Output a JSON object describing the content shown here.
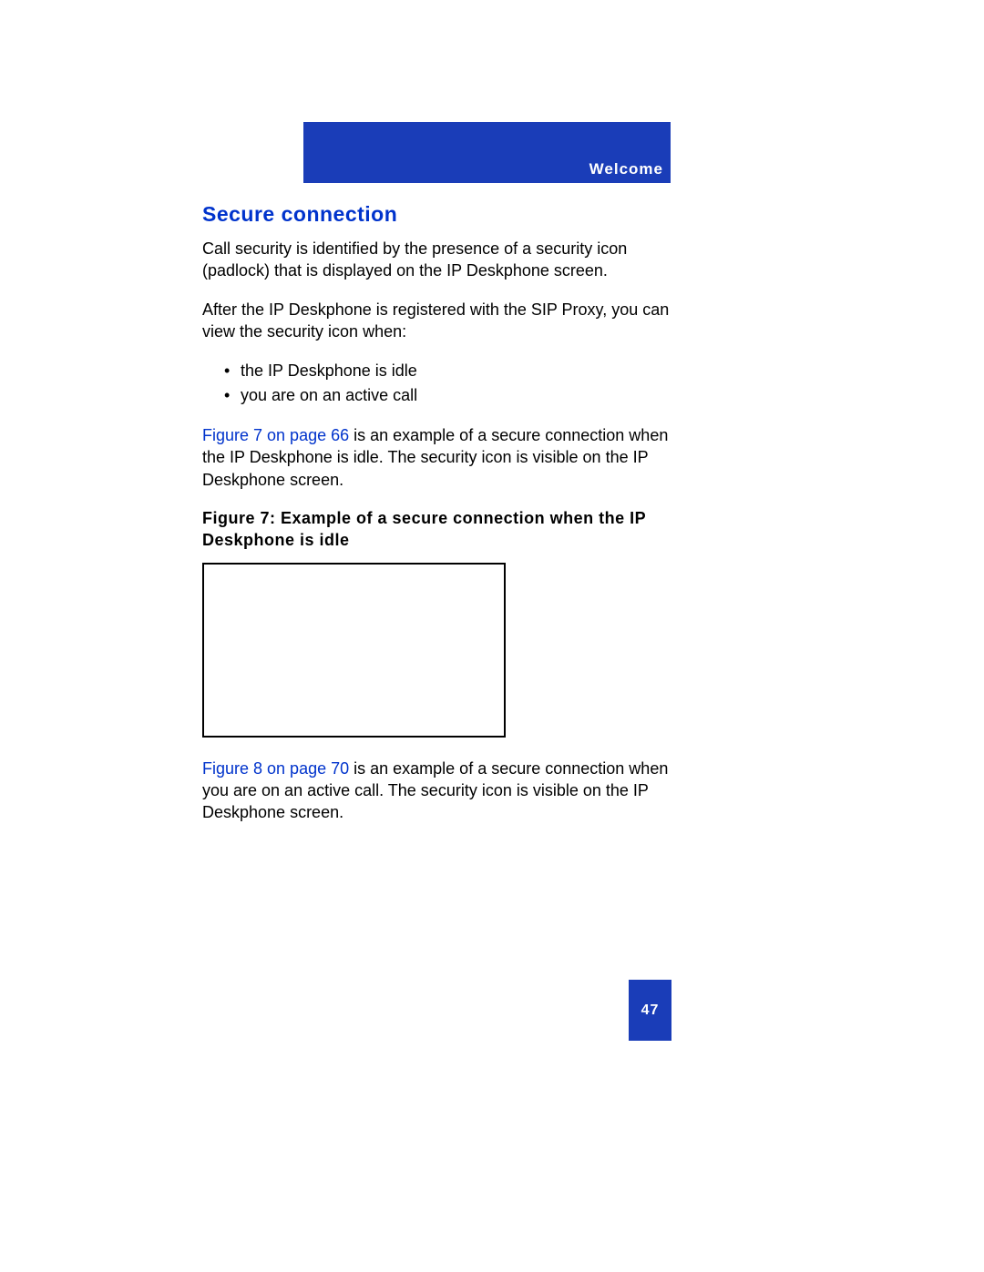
{
  "header": {
    "section_label": "Welcome"
  },
  "content": {
    "title": "Secure connection",
    "para1": "Call security is identified by the presence of a security icon (padlock) that is displayed on the IP Deskphone screen.",
    "para2": "After the IP Deskphone is registered with the SIP Proxy, you can view the security icon when:",
    "bullets": [
      "the IP Deskphone is idle",
      "you are on an active call"
    ],
    "para3_link": "Figure 7 on page 66",
    "para3_rest": " is an example of a secure connection when the IP Deskphone is idle. The security icon is visible on the IP Deskphone screen.",
    "figure_caption": "Figure 7: Example of a secure connection when the IP Deskphone is idle",
    "para4_link": "Figure 8 on page 70",
    "para4_rest": " is an example of a secure connection when you are on an active call. The security icon is visible on the IP Deskphone screen."
  },
  "page_number": "47"
}
